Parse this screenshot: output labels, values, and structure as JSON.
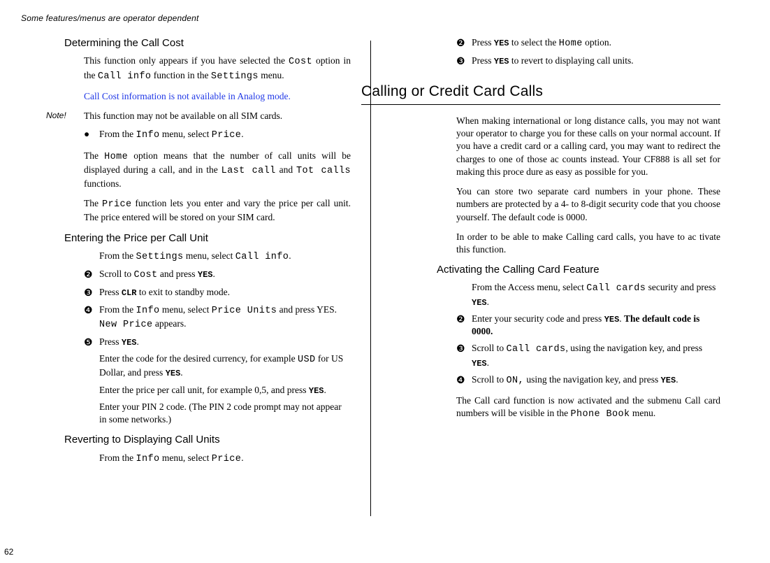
{
  "running_head": "Some features/menus are operator dependent",
  "page_number": "62",
  "left": {
    "h1": "Determining the Call Cost",
    "p1a": "This function only appears if you have selected the ",
    "p1b": " option in the ",
    "p1c": " function in the ",
    "p1d": " menu.",
    "mono_cost": "Cost",
    "mono_callinfo": "Call info",
    "mono_settings": "Settings",
    "blue": "Call Cost information is not available in Analog mode.",
    "note_label": "Note!",
    "note_text": "This function may not be available on all SIM cards.",
    "bullet_a": "From the ",
    "bullet_b": " menu, select ",
    "bullet_c": ".",
    "mono_info": "Info",
    "mono_price": "Price",
    "p2a": "The ",
    "p2b": " option means that the number of call units will be displayed during a call, and in the ",
    "p2c": " and ",
    "p2d": " functions.",
    "mono_home": "Home",
    "mono_lastcall": "Last call",
    "mono_totcalls": "Tot calls",
    "p3a": "The ",
    "p3b": " function lets you enter and vary the price per call unit. The price entered will be stored on your SIM card.",
    "h2": "Entering the Price per Call Unit",
    "s1a": "From the ",
    "s1b": " menu, select ",
    "s1c": ".",
    "s2a": "Scroll to ",
    "s2b": " and press ",
    "s2c": ".",
    "key_yes": "YES",
    "s3a": "Press ",
    "s3b": " to exit to standby mode.",
    "key_clr": "CLR",
    "s4a": "From the ",
    "s4b": " menu, select ",
    "s4c": " and press YES. ",
    "s4d": " appears.",
    "mono_priceunits": "Price Units",
    "mono_newprice": "New Price",
    "s5a": "Press ",
    "s5b": ".",
    "s5c": "Enter the code for the desired currency, for example ",
    "s5d": " for US Dollar, and press ",
    "mono_usd": "USD",
    "s5e": "Enter the price per call unit, for example 0,5, and press ",
    "s5f": "Enter your PIN 2 code. (The PIN 2 code prompt may not appear in some networks.)",
    "h3": "Reverting to Displaying Call Units",
    "r1a": "From the ",
    "r1b": " menu, select ",
    "r1c": "."
  },
  "right": {
    "c2a": "Press ",
    "c2b": " to select the ",
    "c2c": " option.",
    "c3a": "Press ",
    "c3b": " to revert to displaying call units.",
    "section": "Calling or Credit Card Calls",
    "p1": "When making international or long distance calls, you may not want your operator to charge you for these calls on your normal account. If you have a credit card or a calling card, you may want to redirect the charges to one of those ac counts instead. Your CF888 is all set for making this proce dure as easy as possible for you.",
    "p2": "You can store two separate card numbers in your phone. These numbers are protected by a 4- to 8-digit security code that you choose yourself. The default code is 0000.",
    "p3": "In order to be able to make Calling card calls, you have to ac tivate this function.",
    "h1": "Activating the Calling Card Feature",
    "a1a": "From the Access menu, select ",
    "a1b": " security and press ",
    "a1c": ".",
    "mono_callcards": "Call cards",
    "a2a": "Enter your security code and press ",
    "a2b": ". ",
    "a2bold": "The default code is 0000.",
    "a3a": "Scroll to ",
    "a3b": ", using the navigation key, and press ",
    "a4a": "Scroll to ",
    "a4b": "  using the navigation key, and press ",
    "mono_on": "ON,",
    "p4a": "The Call card function is now activated and the submenu Call card numbers will be visible in the ",
    "p4b": " menu.",
    "mono_phonebook": "Phone Book"
  },
  "marks": {
    "dot": "●",
    "n2": "❷",
    "n3": "❸",
    "n4": "❹",
    "n5": "❺"
  }
}
